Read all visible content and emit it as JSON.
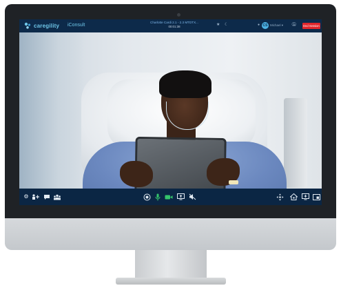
{
  "app": {
    "logo_text": "caregility",
    "product_name": "iConsult"
  },
  "room": {
    "title": "Charlotte Cardi 2.1 - 2.3 MTDTX...",
    "timer": "00:01:38"
  },
  "user": {
    "avatar_initials": "CS",
    "name": "Michael ▾"
  },
  "actions": {
    "end_session_label": "End Session"
  },
  "colors": {
    "header_bg": "#0d2a4a",
    "toolbar_bg": "#0b2644",
    "accent_blue": "#4db3e6",
    "end_red": "#e0252b",
    "active_green": "#35c46b"
  },
  "toolbar": {
    "left": [
      "settings-icon",
      "add-participant-icon",
      "chat-icon",
      "participants-icon"
    ],
    "center": [
      "camera-flip-icon",
      "microphone-icon",
      "video-camera-icon",
      "screen-share-icon",
      "mute-speaker-icon"
    ],
    "right": [
      "pan-tilt-icon",
      "home-preset-icon",
      "snapshot-icon",
      "fullscreen-icon"
    ]
  }
}
